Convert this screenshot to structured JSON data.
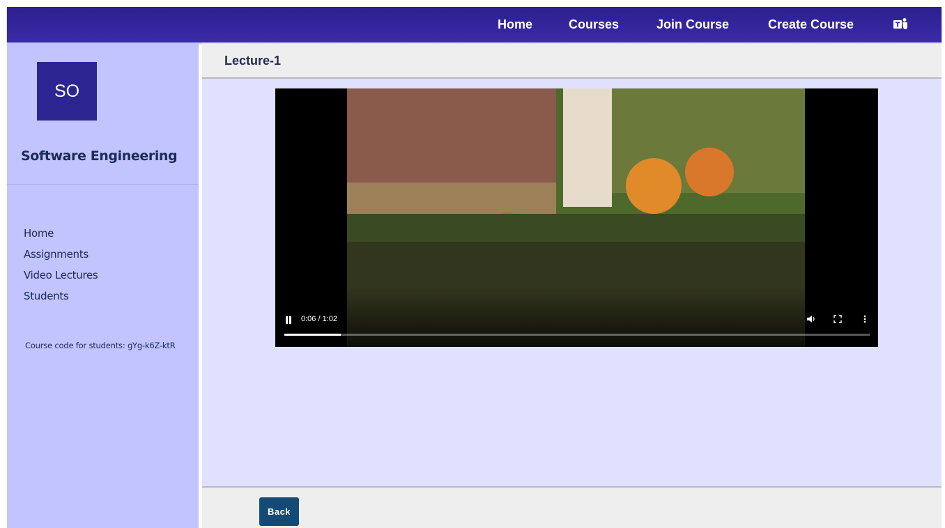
{
  "topbar": {
    "nav": [
      "Home",
      "Courses",
      "Join Course",
      "Create Course"
    ],
    "app_icon": "teams-icon",
    "color": "#2c1f8f"
  },
  "sidebar": {
    "avatar_initials": "SO",
    "course_name": "Software Engineering",
    "items": [
      "Home",
      "Assignments",
      "Video Lectures",
      "Students"
    ],
    "course_code_text": "Course code for students: gYg-k6Z-ktR",
    "color": "#c1c4fe"
  },
  "main": {
    "lecture_title": "Lecture-1",
    "video": {
      "time": "0:06 / 1:02",
      "progress": 0.097,
      "state": "playing",
      "icons": [
        "pause-icon",
        "volume-icon",
        "fullscreen-icon",
        "more-options-icon"
      ]
    },
    "back_label": "Back",
    "background": "#e0e0ff"
  }
}
